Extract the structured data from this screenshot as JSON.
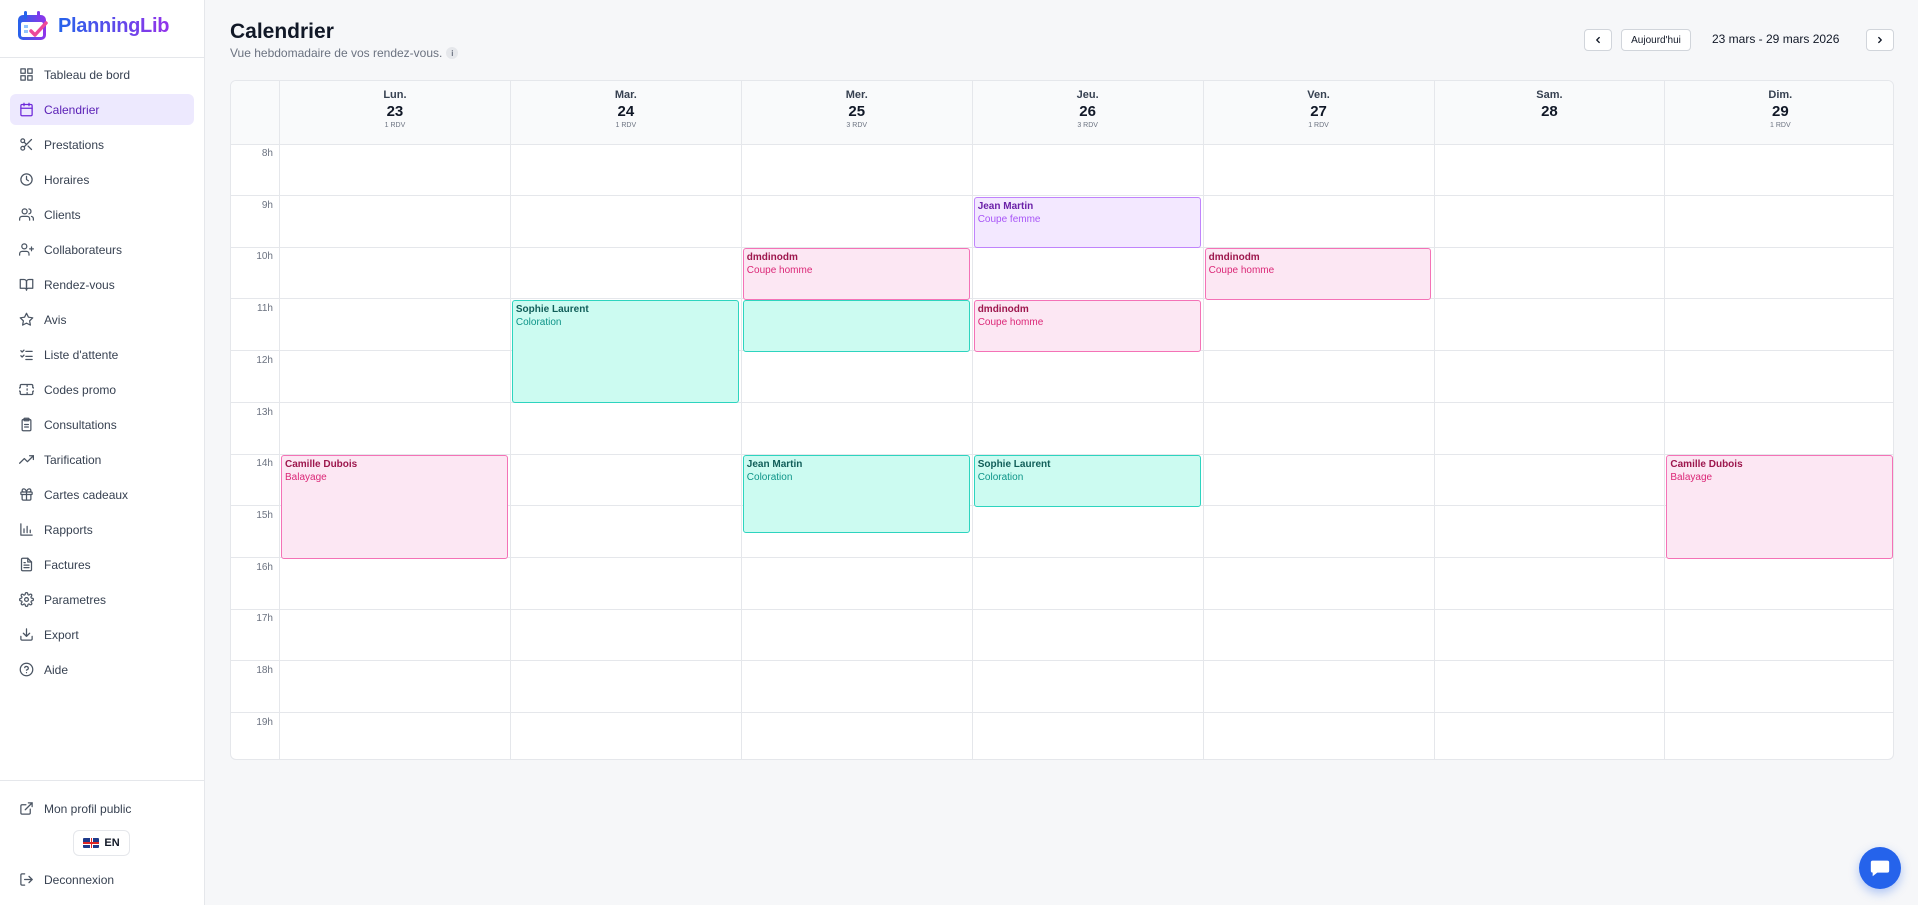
{
  "app": {
    "name": "PlanningLib"
  },
  "sidebar": {
    "items": [
      {
        "label": "Tableau de bord",
        "icon": "dashboard-icon",
        "active": false
      },
      {
        "label": "Calendrier",
        "icon": "calendar-icon",
        "active": true
      },
      {
        "label": "Prestations",
        "icon": "scissors-icon",
        "active": false
      },
      {
        "label": "Horaires",
        "icon": "clock-icon",
        "active": false
      },
      {
        "label": "Clients",
        "icon": "users-icon",
        "active": false
      },
      {
        "label": "Collaborateurs",
        "icon": "user-plus-icon",
        "active": false
      },
      {
        "label": "Rendez-vous",
        "icon": "book-icon",
        "active": false
      },
      {
        "label": "Avis",
        "icon": "star-icon",
        "active": false
      },
      {
        "label": "Liste d'attente",
        "icon": "list-check-icon",
        "active": false
      },
      {
        "label": "Codes promo",
        "icon": "ticket-icon",
        "active": false
      },
      {
        "label": "Consultations",
        "icon": "clipboard-icon",
        "active": false
      },
      {
        "label": "Tarification",
        "icon": "trending-up-icon",
        "active": false
      },
      {
        "label": "Cartes cadeaux",
        "icon": "gift-icon",
        "active": false
      },
      {
        "label": "Rapports",
        "icon": "bar-chart-icon",
        "active": false
      },
      {
        "label": "Factures",
        "icon": "file-text-icon",
        "active": false
      },
      {
        "label": "Parametres",
        "icon": "gear-icon",
        "active": false
      },
      {
        "label": "Export",
        "icon": "download-icon",
        "active": false
      },
      {
        "label": "Aide",
        "icon": "help-circle-icon",
        "active": false
      }
    ],
    "public_profile": "Mon profil public",
    "language": "EN",
    "logout": "Deconnexion"
  },
  "header": {
    "title": "Calendrier",
    "subtitle": "Vue hebdomadaire de vos rendez-vous.",
    "info_mark": "i",
    "today_button": "Aujourd'hui",
    "date_range": "23 mars - 29 mars 2026"
  },
  "calendar": {
    "hours": [
      "8h",
      "9h",
      "10h",
      "11h",
      "12h",
      "13h",
      "14h",
      "15h",
      "16h",
      "17h",
      "18h",
      "19h"
    ],
    "days": [
      {
        "name": "Lun.",
        "num": "23",
        "count": "1 RDV"
      },
      {
        "name": "Mar.",
        "num": "24",
        "count": "1 RDV"
      },
      {
        "name": "Mer.",
        "num": "25",
        "count": "3 RDV"
      },
      {
        "name": "Jeu.",
        "num": "26",
        "count": "3 RDV"
      },
      {
        "name": "Ven.",
        "num": "27",
        "count": "1 RDV"
      },
      {
        "name": "Sam.",
        "num": "28",
        "count": ""
      },
      {
        "name": "Dim.",
        "num": "29",
        "count": "1 RDV"
      }
    ],
    "events": [
      {
        "day": 0,
        "start": 14,
        "end": 16,
        "client": "Camille Dubois",
        "service": "Balayage",
        "color": "pink"
      },
      {
        "day": 1,
        "start": 11,
        "end": 13,
        "client": "Sophie Laurent",
        "service": "Coloration",
        "color": "teal"
      },
      {
        "day": 2,
        "start": 11,
        "end": 12,
        "client": "",
        "service": "",
        "color": "teal"
      },
      {
        "day": 2,
        "start": 10,
        "end": 11,
        "client": "dmdinodm",
        "service": "Coupe homme",
        "color": "pink"
      },
      {
        "day": 2,
        "start": 14,
        "end": 15.5,
        "client": "Jean Martin",
        "service": "Coloration",
        "color": "teal"
      },
      {
        "day": 3,
        "start": 9,
        "end": 10,
        "client": "Jean Martin",
        "service": "Coupe femme",
        "color": "purple"
      },
      {
        "day": 3,
        "start": 11,
        "end": 12,
        "client": "dmdinodm",
        "service": "Coupe homme",
        "color": "pink"
      },
      {
        "day": 3,
        "start": 14,
        "end": 15,
        "client": "Sophie Laurent",
        "service": "Coloration",
        "color": "teal"
      },
      {
        "day": 4,
        "start": 10,
        "end": 11,
        "client": "dmdinodm",
        "service": "Coupe homme",
        "color": "pink"
      },
      {
        "day": 6,
        "start": 14,
        "end": 16,
        "client": "Camille Dubois",
        "service": "Balayage",
        "color": "pink"
      }
    ]
  }
}
